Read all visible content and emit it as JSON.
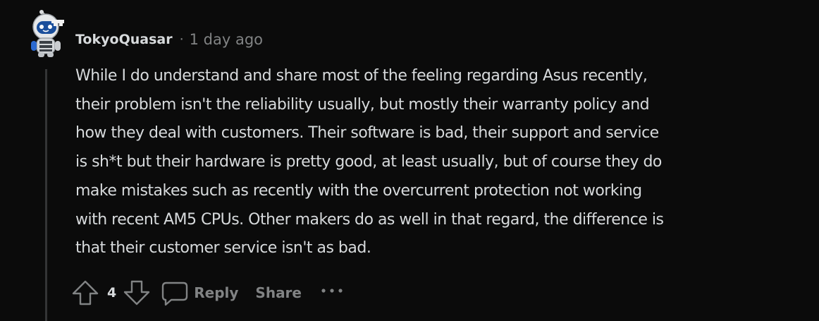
{
  "comment": {
    "author": "TokyoQuasar",
    "separator": "·",
    "timestamp": "1 day ago",
    "body": "While I do understand and share most of the feeling regarding Asus recently,\ntheir problem isn't the reliability usually, but mostly their warranty policy and\nhow they deal with customers. Their software is bad, their support and service\nis sh*t but their hardware is pretty good, at least usually, but of course they do\nmake mistakes such as recently with the overcurrent protection not working\nwith recent AM5 CPUs. Other makers do as well in that regard, the difference is\nthat their customer service isn't as bad."
  },
  "actions": {
    "vote_count": "4",
    "reply_label": "Reply",
    "share_label": "Share",
    "upvote_icon": "upvote-arrow-icon",
    "downvote_icon": "downvote-arrow-icon",
    "reply_icon": "speech-bubble-icon",
    "more_icon": "ellipsis-icon"
  },
  "colors": {
    "background": "#0b0b0b",
    "text": "#d7dadc",
    "muted": "#818384",
    "thread_line": "#343536"
  }
}
